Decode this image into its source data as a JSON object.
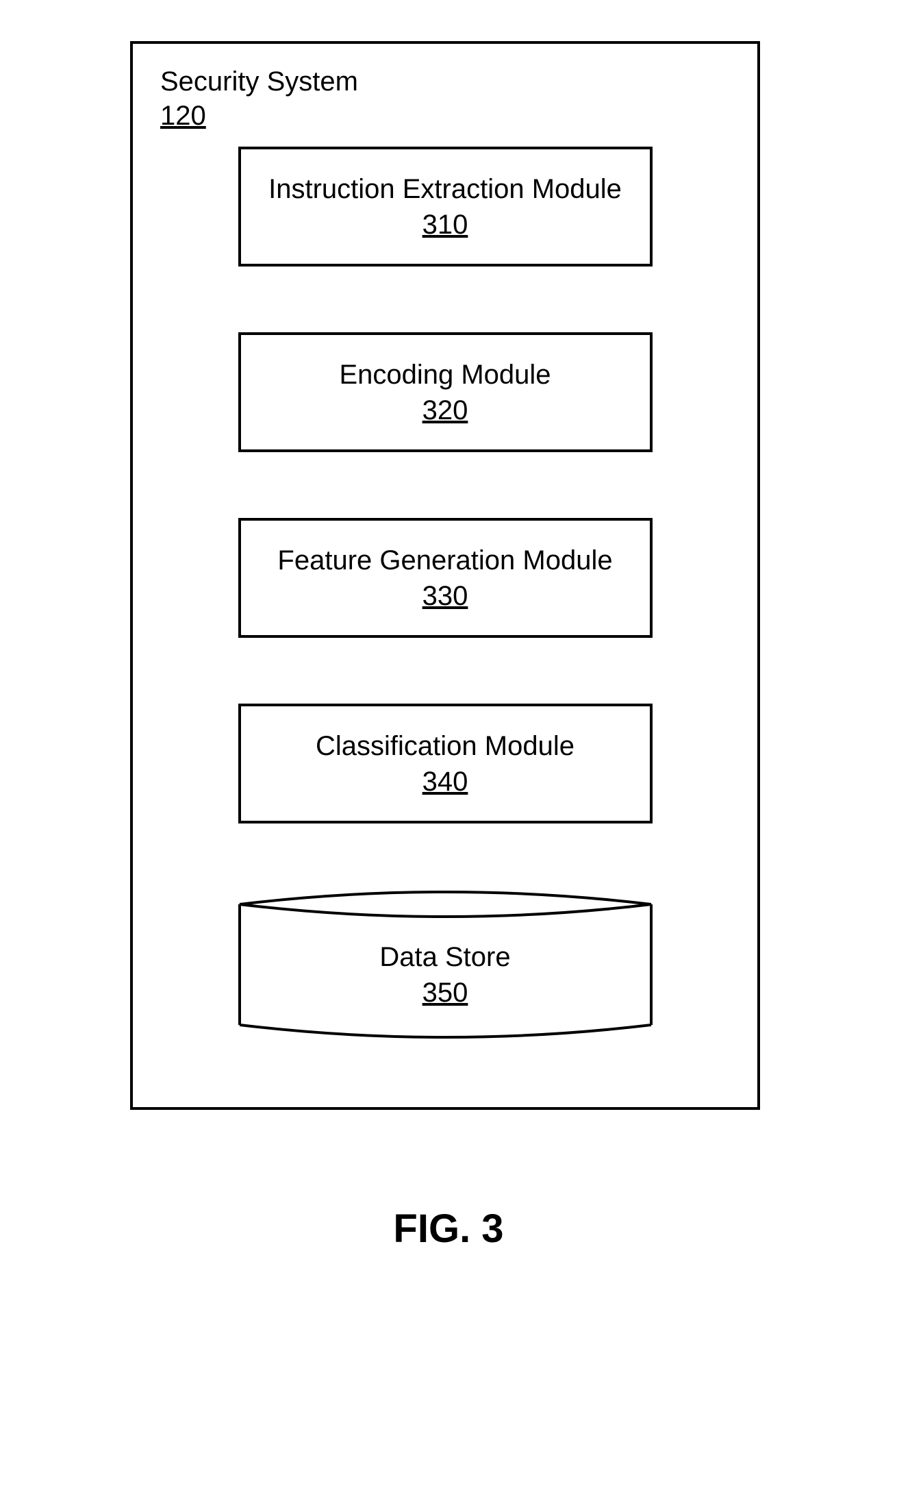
{
  "container": {
    "title": "Security System",
    "ref": "120"
  },
  "modules": [
    {
      "name": "Instruction Extraction Module",
      "ref": "310"
    },
    {
      "name": "Encoding Module",
      "ref": "320"
    },
    {
      "name": "Feature Generation Module",
      "ref": "330"
    },
    {
      "name": "Classification Module",
      "ref": "340"
    }
  ],
  "datastore": {
    "name": "Data Store",
    "ref": "350"
  },
  "figure_caption": "FIG. 3"
}
